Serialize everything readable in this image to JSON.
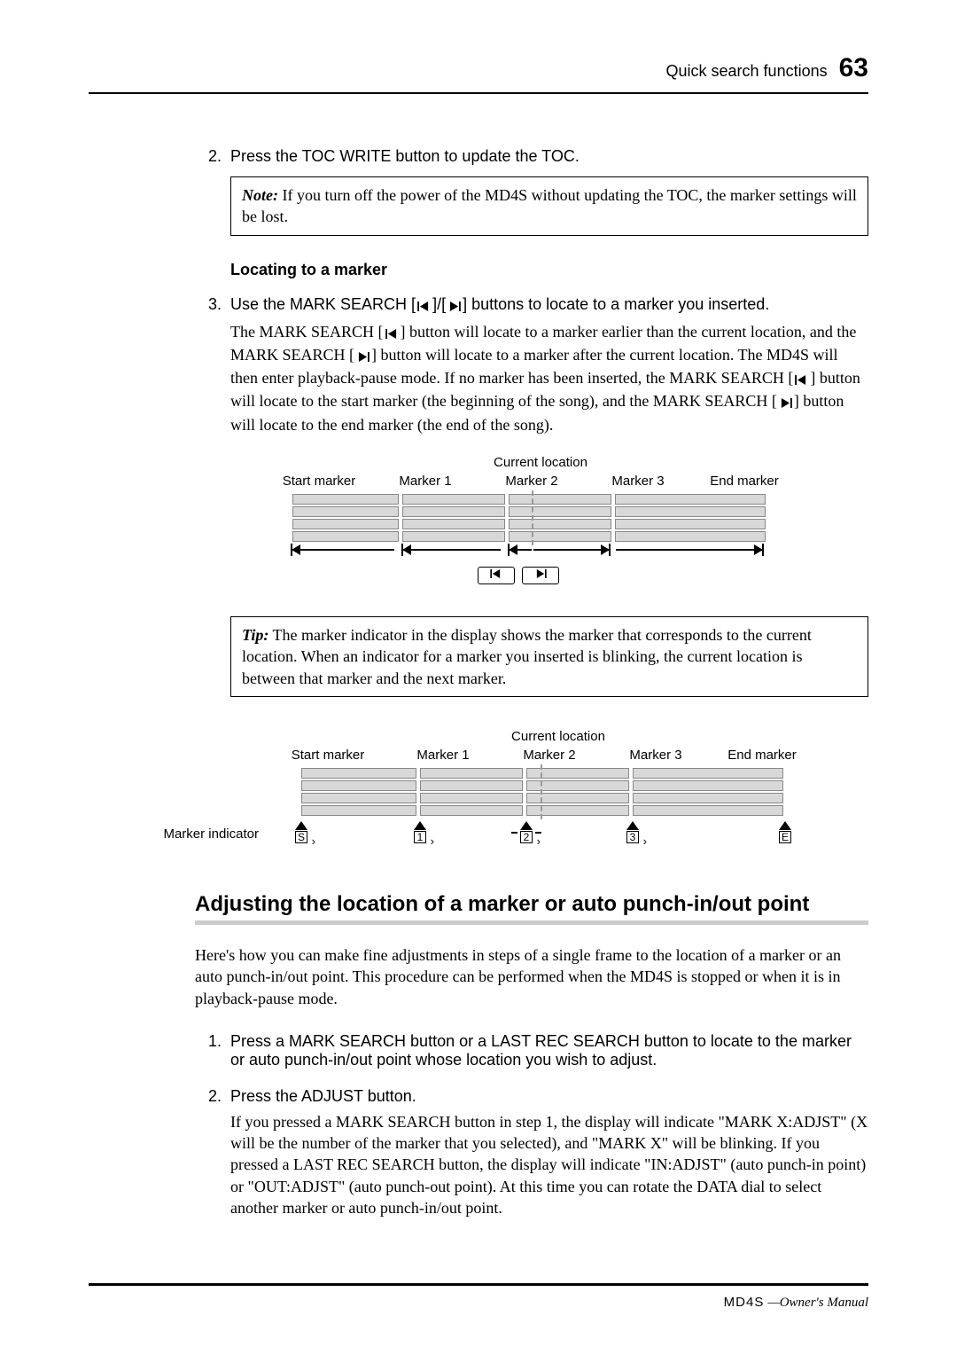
{
  "header": {
    "section": "Quick search functions",
    "page": "63"
  },
  "steps_top": {
    "s2": {
      "num": "2.",
      "title": "Press the TOC WRITE button to update the TOC."
    },
    "note": {
      "label": "Note:",
      "text": "If you turn off the power of the MD4S without updating the TOC, the marker settings will be lost."
    },
    "subhead": "Locating to a marker",
    "s3": {
      "num": "3.",
      "title_a": "Use the MARK SEARCH [",
      "title_b": "]/[",
      "title_c": "] buttons to locate to a marker you inserted.",
      "body_a": "The MARK SEARCH [",
      "body_b": "] button will locate to a marker earlier than the current location, and the MARK SEARCH [",
      "body_c": "] button will locate to a marker after the current location. The MD4S will then enter playback-pause mode. If no marker has been inserted, the MARK SEARCH [",
      "body_d": "] button will locate to the start marker (the beginning of the song), and the MARK SEARCH [",
      "body_e": "] button will locate to the end marker (the end of the song)."
    }
  },
  "diagram": {
    "current": "Current location",
    "labels": [
      "Start marker",
      "Marker 1",
      "Marker 2",
      "Marker 3",
      "End marker"
    ],
    "indicator_label": "Marker indicator",
    "indicators": [
      "S",
      "1",
      "2",
      "3",
      "E"
    ]
  },
  "tip": {
    "label": "Tip:",
    "text": "The marker indicator in the display shows the marker that corresponds to the current location. When an indicator for a marker you inserted is blinking, the current location is between that marker and the next marker."
  },
  "section2": {
    "title": "Adjusting the location of a marker or auto punch-in/out point",
    "intro": "Here's how you can make fine adjustments in steps of a single frame to the location of a marker or an auto punch-in/out point. This procedure can be performed when the MD4S is stopped or when it is in playback-pause mode.",
    "s1": {
      "num": "1.",
      "title": "Press a MARK SEARCH button or a LAST REC SEARCH button to locate to the marker or auto punch-in/out point whose location you wish to adjust."
    },
    "s2": {
      "num": "2.",
      "title": "Press the ADJUST button.",
      "body": "If you pressed a MARK SEARCH button in step 1, the display will indicate \"MARK X:ADJST\" (X will be the number of the marker that you selected), and \"MARK X\" will be blinking. If you pressed a LAST REC SEARCH button, the display will indicate \"IN:ADJST\" (auto punch-in point) or \"OUT:ADJST\" (auto punch-out point). At this time you can rotate the DATA dial to select another marker or auto punch-in/out point."
    }
  },
  "footer": {
    "logo": "MD4S",
    "text": "—Owner's Manual"
  }
}
